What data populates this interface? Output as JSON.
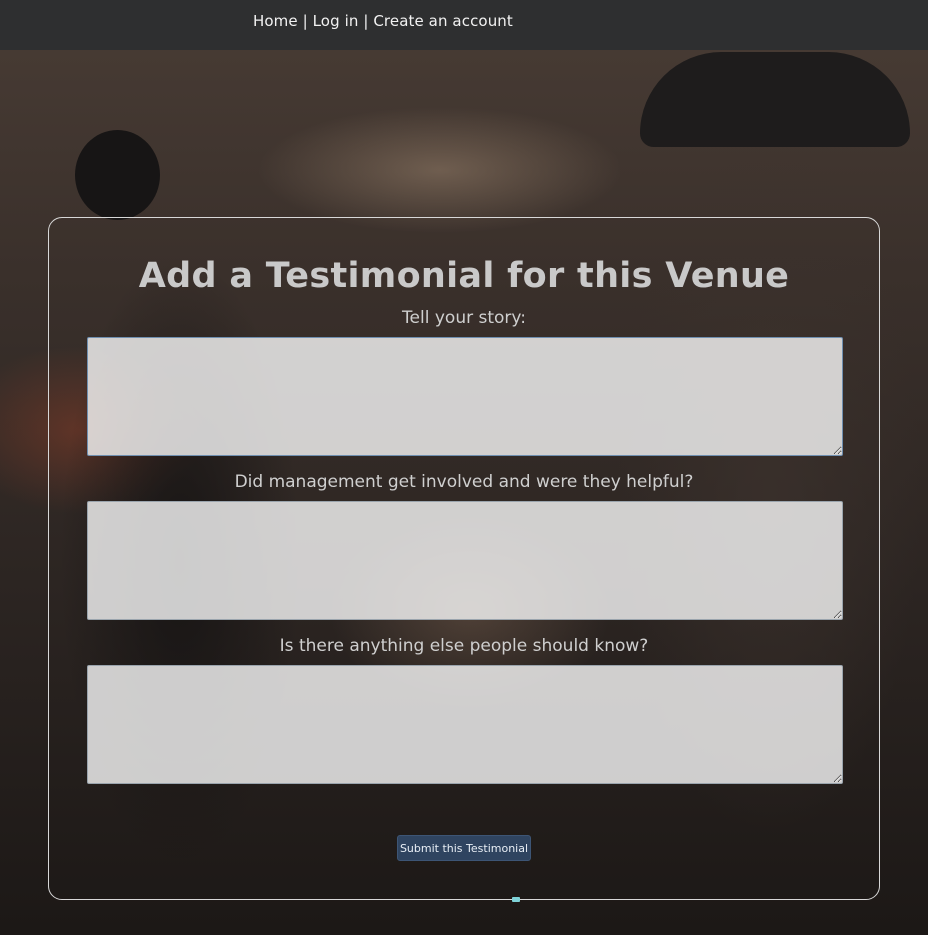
{
  "nav": {
    "home": "Home",
    "separator": "|",
    "login": "Log in",
    "create_account": "Create an account"
  },
  "form": {
    "title": "Add a Testimonial for this Venue",
    "fields": [
      {
        "label": "Tell your story:",
        "value": ""
      },
      {
        "label": "Did management get involved and were they helpful?",
        "value": ""
      },
      {
        "label": "Is there anything else people should know?",
        "value": ""
      }
    ],
    "submit_label": "Submit this Testimonial"
  },
  "colors": {
    "navbar": "#2e2f30",
    "submit_button": "#2f4460",
    "card_border": "#d8d8d8"
  }
}
